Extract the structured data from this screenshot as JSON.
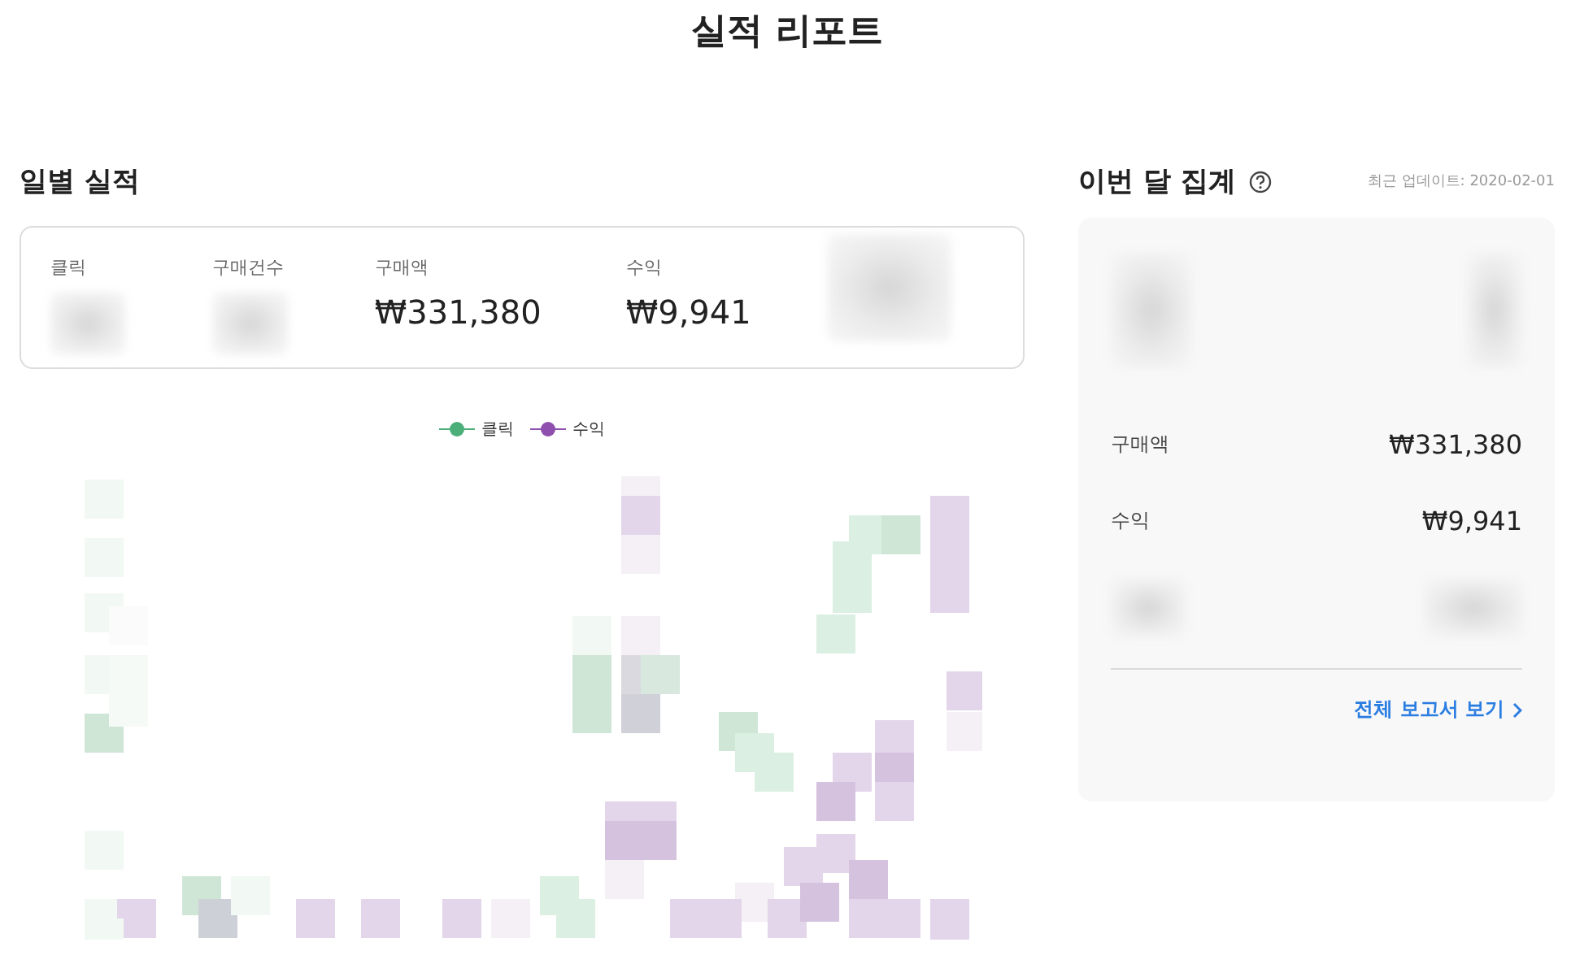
{
  "page_title": "실적 리포트",
  "daily": {
    "heading": "일별 실적",
    "metrics": [
      {
        "kind": "blurred",
        "label": "클릭"
      },
      {
        "kind": "blurred",
        "label": "구매건수"
      },
      {
        "kind": "value",
        "label": "구매액",
        "value": "₩331,380"
      },
      {
        "kind": "value",
        "label": "수익",
        "value": "₩9,941"
      },
      {
        "kind": "blurred_tall"
      }
    ],
    "legend": [
      {
        "label": "클릭",
        "color": "#4caf7a"
      },
      {
        "label": "수익",
        "color": "#8e4fae"
      }
    ]
  },
  "monthly": {
    "heading": "이번 달 집계",
    "updated": "최근 업데이트: 2020-02-01",
    "rows": [
      {
        "kind": "blurred_tall"
      },
      {
        "kind": "value",
        "label": "구매액",
        "value": "₩331,380"
      },
      {
        "kind": "value",
        "label": "수익",
        "value": "₩9,941"
      },
      {
        "kind": "blurred"
      }
    ],
    "link": "전체 보고서 보기"
  }
}
